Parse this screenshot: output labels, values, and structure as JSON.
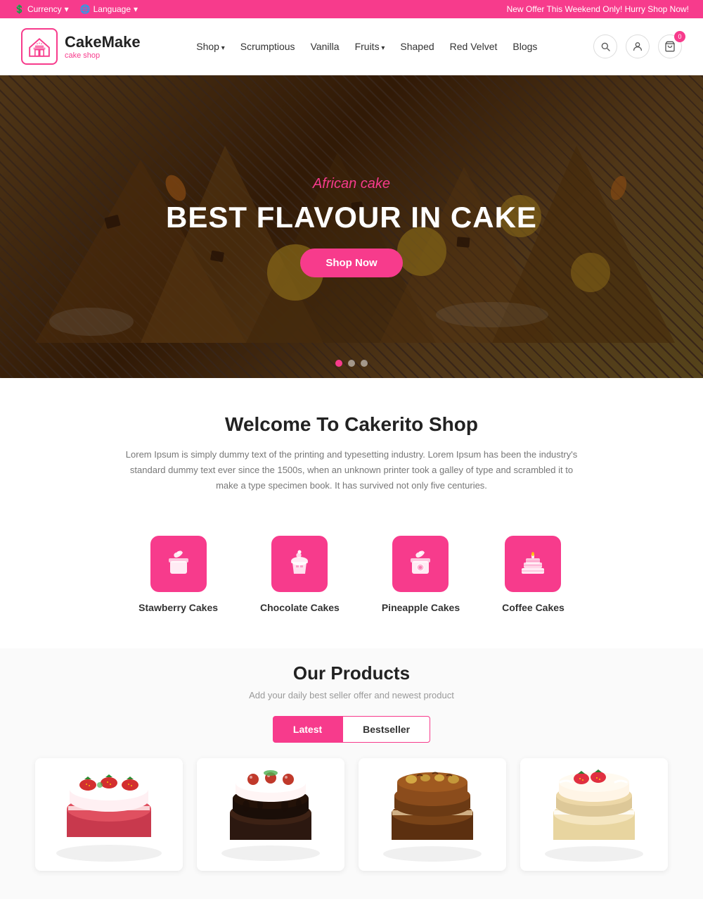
{
  "topbar": {
    "left": [
      {
        "id": "currency",
        "label": "Currency",
        "icon": "💲"
      },
      {
        "id": "language",
        "label": "Language",
        "icon": "🌐"
      }
    ],
    "promo": "New Offer This Weekend Only! Hurry Shop Now!"
  },
  "header": {
    "logo": {
      "name": "CakeMake",
      "tagline": "cake shop"
    },
    "nav": [
      {
        "id": "shop",
        "label": "Shop",
        "hasDropdown": true
      },
      {
        "id": "scrumptious",
        "label": "Scrumptious"
      },
      {
        "id": "vanilla",
        "label": "Vanilla"
      },
      {
        "id": "fruits",
        "label": "Fruits",
        "hasDropdown": true
      },
      {
        "id": "shaped",
        "label": "Shaped"
      },
      {
        "id": "red-velvet",
        "label": "Red Velvet"
      },
      {
        "id": "blogs",
        "label": "Blogs"
      }
    ],
    "cart_count": "0"
  },
  "hero": {
    "subtitle": "African cake",
    "title": "BEST FLAVOUR IN CAKE",
    "cta": "Shop Now",
    "dots": [
      true,
      false,
      false
    ]
  },
  "welcome": {
    "heading": "Welcome To Cakerito Shop",
    "description": "Lorem Ipsum is simply dummy text of the printing and typesetting industry. Lorem Ipsum has been the industry's standard dummy text ever since the 1500s, when an unknown printer took a galley of type and scrambled it to make a type specimen book. It has survived not only five centuries."
  },
  "categories": [
    {
      "id": "strawberry",
      "label": "Stawberry Cakes"
    },
    {
      "id": "chocolate",
      "label": "Chocolate Cakes"
    },
    {
      "id": "pineapple",
      "label": "Pineapple Cakes"
    },
    {
      "id": "coffee",
      "label": "Coffee Cakes"
    }
  ],
  "products": {
    "heading": "Our Products",
    "subheading": "Add your daily best seller offer and newest product",
    "tabs": [
      {
        "id": "latest",
        "label": "Latest",
        "active": true
      },
      {
        "id": "bestseller",
        "label": "Bestseller",
        "active": false
      }
    ],
    "items": [
      {
        "id": 1,
        "type": "strawberry"
      },
      {
        "id": 2,
        "type": "chocolate"
      },
      {
        "id": 3,
        "type": "nut"
      },
      {
        "id": 4,
        "type": "vanilla"
      }
    ]
  },
  "colors": {
    "primary": "#f73b8c",
    "dark": "#222",
    "gray": "#777"
  }
}
